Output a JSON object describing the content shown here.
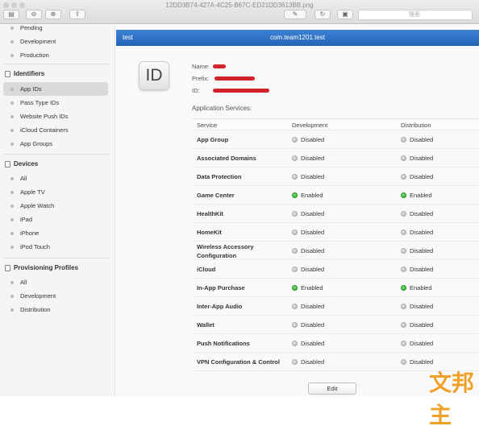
{
  "window": {
    "file_title": "12DD3B74-427A-4C25-B67C-ED21DD3613BB.png",
    "search_placeholder": "搜索"
  },
  "sidebar": {
    "certificates_items": [
      "Pending",
      "Development",
      "Production"
    ],
    "identifiers": {
      "title": "Identifiers",
      "items": [
        "App IDs",
        "Pass Type IDs",
        "Website Push IDs",
        "iCloud Containers",
        "App Groups"
      ],
      "selected": "App IDs"
    },
    "devices": {
      "title": "Devices",
      "items": [
        "All",
        "Apple TV",
        "Apple Watch",
        "iPad",
        "iPhone",
        "iPod Touch"
      ]
    },
    "profiles": {
      "title": "Provisioning Profiles",
      "items": [
        "All",
        "Development",
        "Distribution"
      ]
    }
  },
  "detail": {
    "header_left": "test",
    "header_center": "com.team1201.test",
    "badge": "ID",
    "name_label": "Name:",
    "prefix_label": "Prefix:",
    "id_label": "ID:",
    "services_title": "Application Services:",
    "columns": {
      "service": "Service",
      "development": "Development",
      "distribution": "Distribution"
    },
    "services": [
      {
        "name": "App Group",
        "dev": "Disabled",
        "dist": "Disabled",
        "dev_on": false,
        "dist_on": false
      },
      {
        "name": "Associated Domains",
        "dev": "Disabled",
        "dist": "Disabled",
        "dev_on": false,
        "dist_on": false
      },
      {
        "name": "Data Protection",
        "dev": "Disabled",
        "dist": "Disabled",
        "dev_on": false,
        "dist_on": false
      },
      {
        "name": "Game Center",
        "dev": "Enabled",
        "dist": "Enabled",
        "dev_on": true,
        "dist_on": true
      },
      {
        "name": "HealthKit",
        "dev": "Disabled",
        "dist": "Disabled",
        "dev_on": false,
        "dist_on": false
      },
      {
        "name": "HomeKit",
        "dev": "Disabled",
        "dist": "Disabled",
        "dev_on": false,
        "dist_on": false
      },
      {
        "name": "Wireless Accessory Configuration",
        "dev": "Disabled",
        "dist": "Disabled",
        "dev_on": false,
        "dist_on": false
      },
      {
        "name": "iCloud",
        "dev": "Disabled",
        "dist": "Disabled",
        "dev_on": false,
        "dist_on": false
      },
      {
        "name": "In-App Purchase",
        "dev": "Enabled",
        "dist": "Enabled",
        "dev_on": true,
        "dist_on": true
      },
      {
        "name": "Inter-App Audio",
        "dev": "Disabled",
        "dist": "Disabled",
        "dev_on": false,
        "dist_on": false
      },
      {
        "name": "Wallet",
        "dev": "Disabled",
        "dist": "Disabled",
        "dev_on": false,
        "dist_on": false
      },
      {
        "name": "Push Notifications",
        "dev": "Disabled",
        "dist": "Disabled",
        "dev_on": false,
        "dist_on": false
      },
      {
        "name": "VPN Configuration & Control",
        "dev": "Disabled",
        "dist": "Disabled",
        "dev_on": false,
        "dist_on": false
      }
    ],
    "edit_label": "Edit"
  },
  "watermark": "文邦主",
  "colors": {
    "header_blue": "#2f74c8",
    "enabled_green": "#26a226",
    "redaction_red": "#d0242a"
  }
}
